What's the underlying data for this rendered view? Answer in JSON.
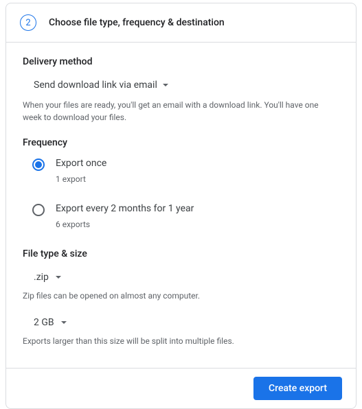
{
  "header": {
    "step": "2",
    "title": "Choose file type, frequency & destination"
  },
  "delivery": {
    "title": "Delivery method",
    "selected": "Send download link via email",
    "description": "When your files are ready, you'll get an email with a download link. You'll have one week to download your files."
  },
  "frequency": {
    "title": "Frequency",
    "options": [
      {
        "label": "Export once",
        "sublabel": "1 export",
        "selected": true
      },
      {
        "label": "Export every 2 months for 1 year",
        "sublabel": "6 exports",
        "selected": false
      }
    ]
  },
  "filetype": {
    "title": "File type & size",
    "type_selected": ".zip",
    "type_description": "Zip files can be opened on almost any computer.",
    "size_selected": "2 GB",
    "size_description": "Exports larger than this size will be split into multiple files."
  },
  "footer": {
    "create_label": "Create export"
  }
}
